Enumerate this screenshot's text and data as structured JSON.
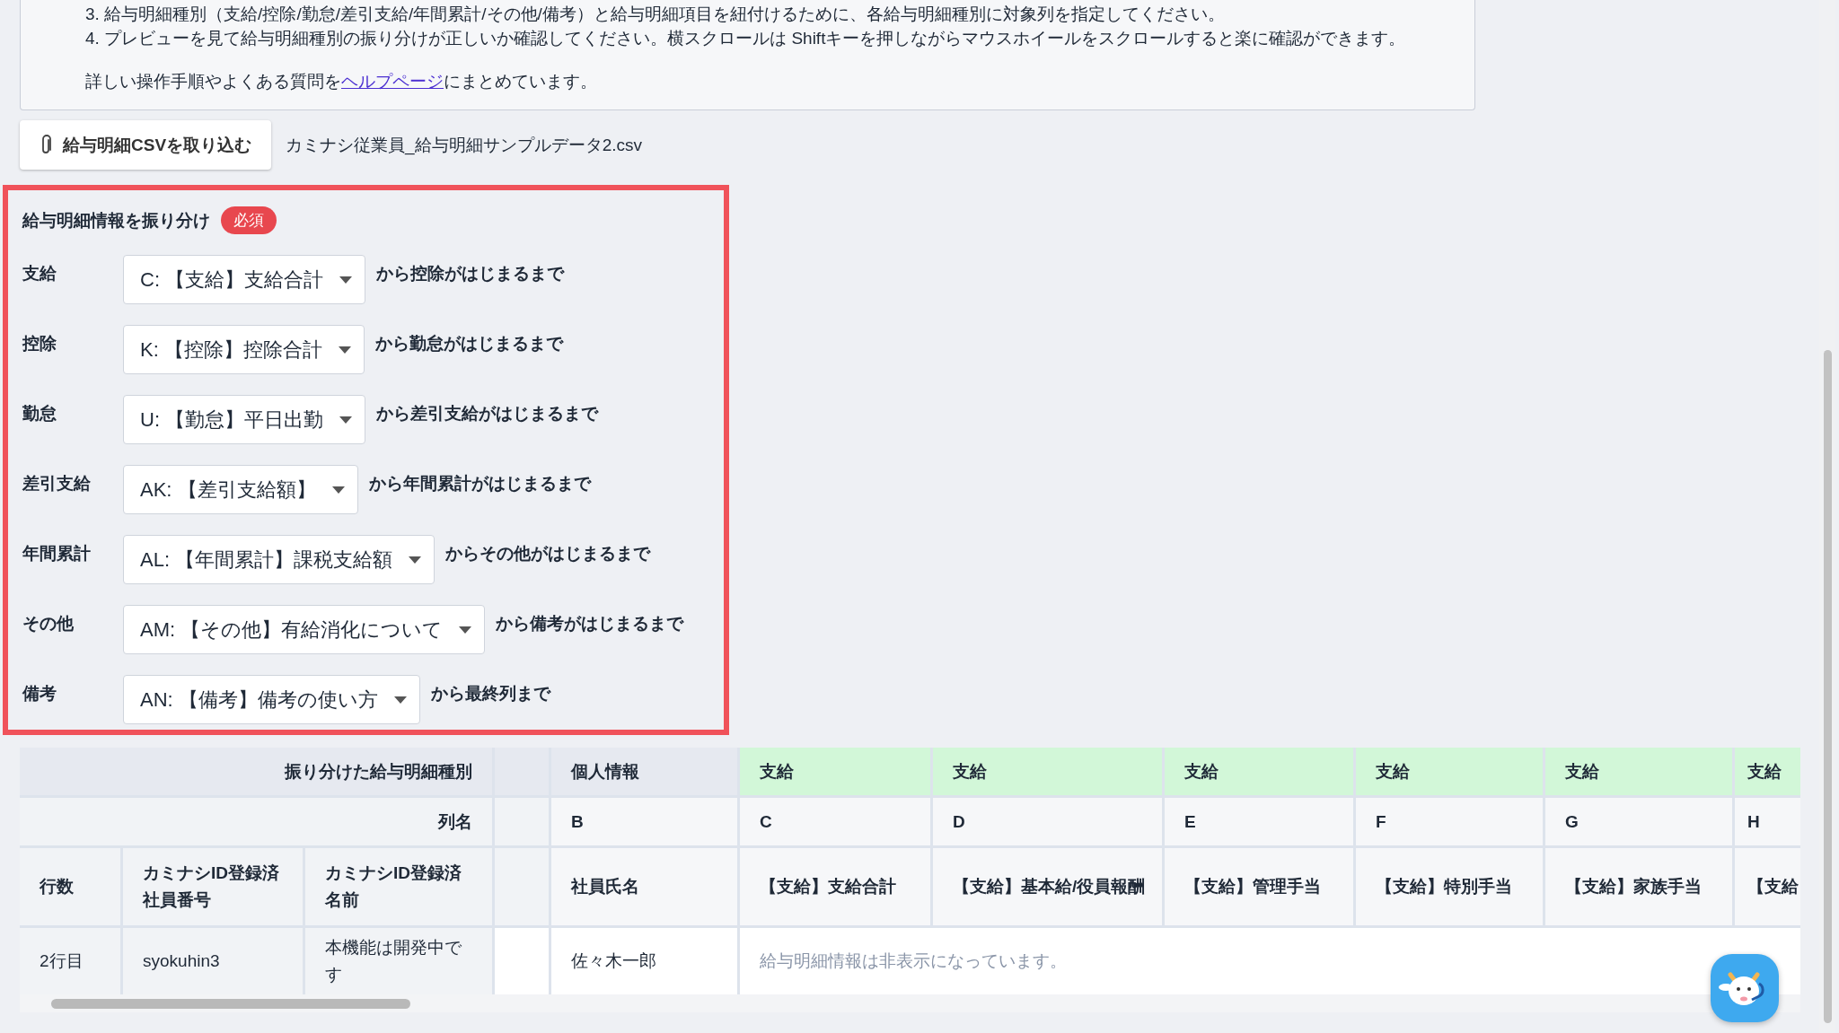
{
  "instructions": {
    "lines": [
      "3. 給与明細種別（支給/控除/勤怠/差引支給/年間累計/その他/備考）と給与明細項目を紐付けるために、各給与明細種別に対象列を指定してください。",
      "4. プレビューを見て給与明細種別の振り分けが正しいか確認してください。横スクロールは Shiftキーを押しながらマウスホイールをスクロールすると楽に確認ができます。"
    ],
    "help": {
      "prefix": "詳しい操作手順やよくある質問を",
      "link": "ヘルプページ",
      "suffix": "にまとめています。"
    }
  },
  "import_button": {
    "label": "給与明細CSVを取り込む"
  },
  "file_name": "カミナシ従業員_給与明細サンプルデータ2.csv",
  "mapping": {
    "title": "給与明細情報を振り分け",
    "badge": "必須",
    "rows": [
      {
        "label": "支給",
        "value": "C: 【支給】支給合計",
        "suffix": "から控除がはじまるまで"
      },
      {
        "label": "控除",
        "value": "K: 【控除】控除合計",
        "suffix": "から勤怠がはじまるまで"
      },
      {
        "label": "勤怠",
        "value": "U: 【勤怠】平日出勤",
        "suffix": "から差引支給がはじまるまで"
      },
      {
        "label": "差引支給",
        "value": "AK: 【差引支給額】",
        "suffix": "から年間累計がはじまるまで"
      },
      {
        "label": "年間累計",
        "value": "AL: 【年間累計】課税支給額",
        "suffix": "からその他がはじまるまで"
      },
      {
        "label": "その他",
        "value": "AM: 【その他】有給消化について",
        "suffix": "から備考がはじまるまで"
      },
      {
        "label": "備考",
        "value": "AN: 【備考】備考の使い方",
        "suffix": "から最終列まで"
      }
    ]
  },
  "table": {
    "group_row": {
      "label": "振り分けた給与明細種別",
      "cells": [
        {
          "text": "個人情報",
          "kind": "personal"
        },
        {
          "text": "支給",
          "kind": "payment"
        },
        {
          "text": "支給",
          "kind": "payment"
        },
        {
          "text": "支給",
          "kind": "payment"
        },
        {
          "text": "支給",
          "kind": "payment"
        },
        {
          "text": "支給",
          "kind": "payment"
        },
        {
          "text": "支給",
          "kind": "payment"
        }
      ]
    },
    "column_row": {
      "label": "列名",
      "cells": [
        "B",
        "C",
        "D",
        "E",
        "F",
        "G",
        "H"
      ]
    },
    "header_row": {
      "fixed": [
        [
          "行数"
        ],
        [
          "カミナシID登録済",
          "社員番号"
        ],
        [
          "カミナシID登録済",
          "名前"
        ]
      ],
      "cells": [
        "社員氏名",
        "【支給】支給合計",
        "【支給】基本給/役員報酬",
        "【支給】管理手当",
        "【支給】特別手当",
        "【支給】家族手当",
        "【支給"
      ]
    },
    "data_row": {
      "fixed": [
        "2行目",
        "syokuhin3",
        "本機能は開発中です"
      ],
      "name": "佐々木一郎",
      "notice": "給与明細情報は非表示になっています。"
    }
  }
}
